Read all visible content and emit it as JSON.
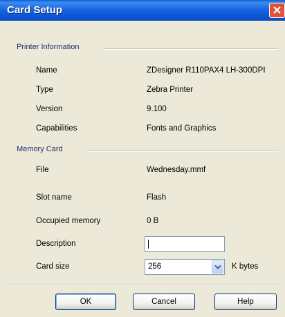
{
  "window": {
    "title": "Card Setup"
  },
  "printer_info": {
    "group_label": "Printer Information",
    "rows": [
      {
        "label": "Name",
        "value": "ZDesigner R110PAX4 LH-300DPI"
      },
      {
        "label": "Type",
        "value": "Zebra Printer"
      },
      {
        "label": "Version",
        "value": "9.100"
      },
      {
        "label": "Capabilities",
        "value": "Fonts and Graphics"
      }
    ]
  },
  "memory_card": {
    "group_label": "Memory Card",
    "rows": [
      {
        "label": "File",
        "value": "Wednesday.mmf"
      },
      {
        "label": "Slot name",
        "value": "Flash"
      },
      {
        "label": "Occupied memory",
        "value": "0 B"
      }
    ],
    "description": {
      "label": "Description",
      "value": ""
    },
    "card_size": {
      "label": "Card size",
      "value": "256",
      "unit": "K bytes"
    }
  },
  "buttons": {
    "ok": "OK",
    "cancel": "Cancel",
    "help": "Help"
  }
}
